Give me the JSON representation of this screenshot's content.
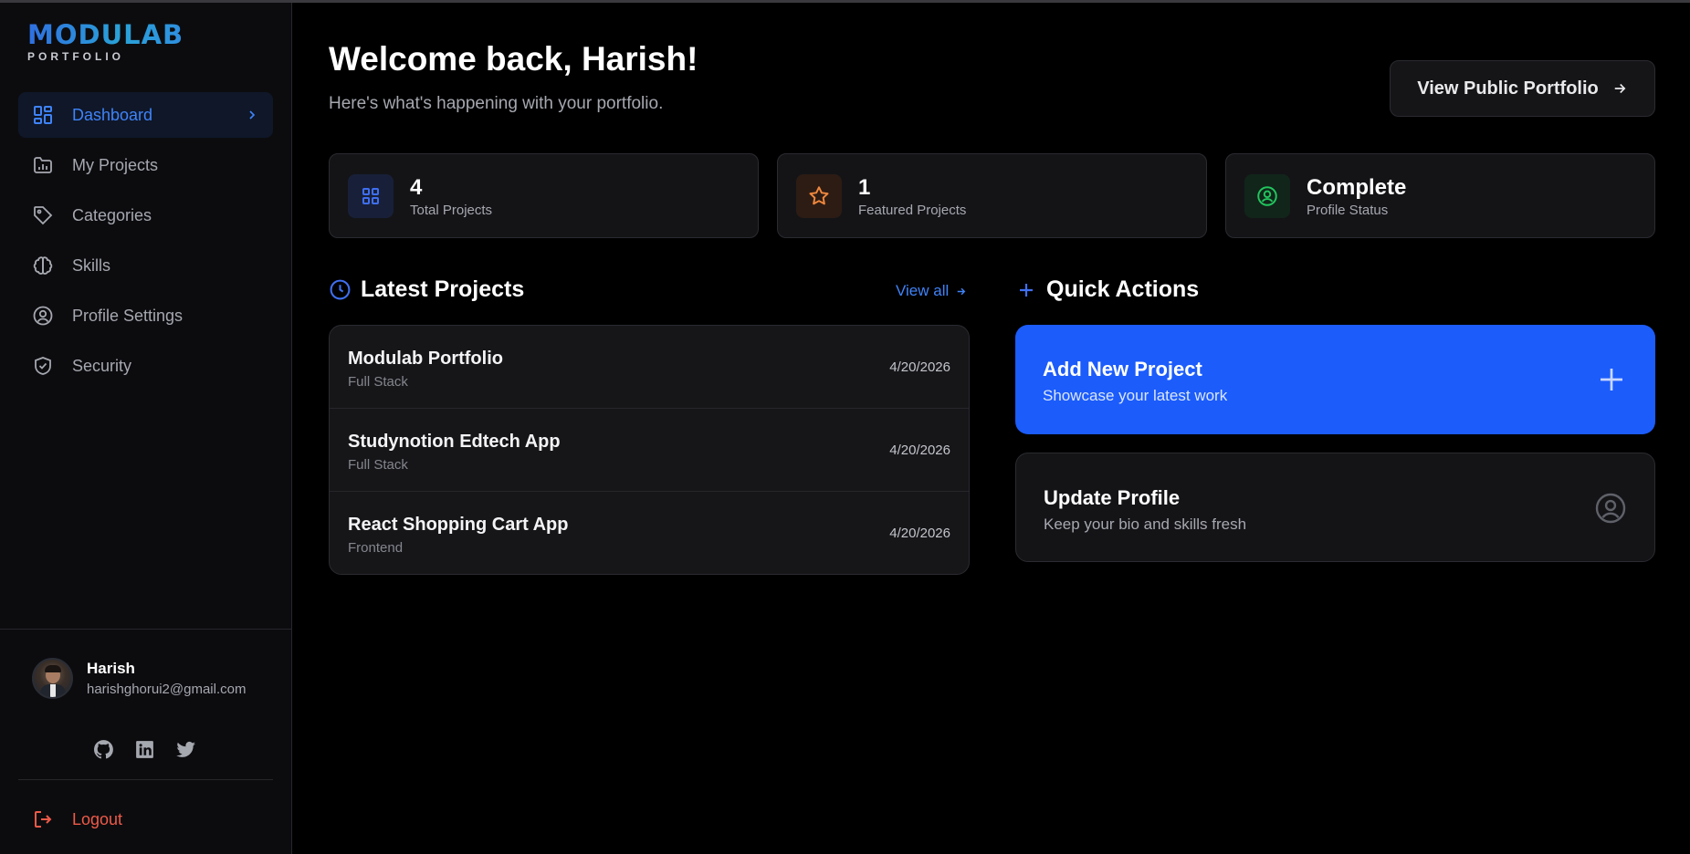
{
  "brand": {
    "name": "MODULAB",
    "tagline": "PORTFOLIO"
  },
  "sidebar": {
    "items": [
      {
        "label": "Dashboard",
        "icon": "dashboard-icon",
        "active": true
      },
      {
        "label": "My Projects",
        "icon": "folder-chart-icon"
      },
      {
        "label": "Categories",
        "icon": "tag-icon"
      },
      {
        "label": "Skills",
        "icon": "brain-icon"
      },
      {
        "label": "Profile Settings",
        "icon": "user-circle-icon"
      },
      {
        "label": "Security",
        "icon": "shield-check-icon"
      }
    ],
    "user": {
      "name": "Harish",
      "email": "harishghorui2@gmail.com"
    },
    "socials": [
      "github-icon",
      "linkedin-icon",
      "twitter-icon"
    ],
    "logout_label": "Logout"
  },
  "header": {
    "title": "Welcome back, Harish!",
    "subtitle": "Here's what's happening with your portfolio.",
    "view_public_label": "View Public Portfolio"
  },
  "stats": [
    {
      "value": "4",
      "label": "Total Projects",
      "icon": "grid-icon",
      "color": "#3f6ff0"
    },
    {
      "value": "1",
      "label": "Featured Projects",
      "icon": "star-icon",
      "color": "#f0883e"
    },
    {
      "value": "Complete",
      "label": "Profile Status",
      "icon": "user-check-icon",
      "color": "#22c55e"
    }
  ],
  "latest_projects": {
    "title": "Latest Projects",
    "view_all_label": "View all",
    "items": [
      {
        "title": "Modulab Portfolio",
        "category": "Full Stack",
        "date": "4/20/2026"
      },
      {
        "title": "Studynotion Edtech App",
        "category": "Full Stack",
        "date": "4/20/2026"
      },
      {
        "title": "React Shopping Cart App",
        "category": "Frontend",
        "date": "4/20/2026"
      }
    ]
  },
  "quick_actions": {
    "title": "Quick Actions",
    "items": [
      {
        "title": "Add New Project",
        "subtitle": "Showcase your latest work",
        "icon": "plus-icon"
      },
      {
        "title": "Update Profile",
        "subtitle": "Keep your bio and skills fresh",
        "icon": "user-circle-icon"
      }
    ]
  },
  "colors": {
    "accent": "#3f83f8",
    "primary_button": "#1b5cfb",
    "danger": "#ef5a48",
    "background": "#000000"
  }
}
